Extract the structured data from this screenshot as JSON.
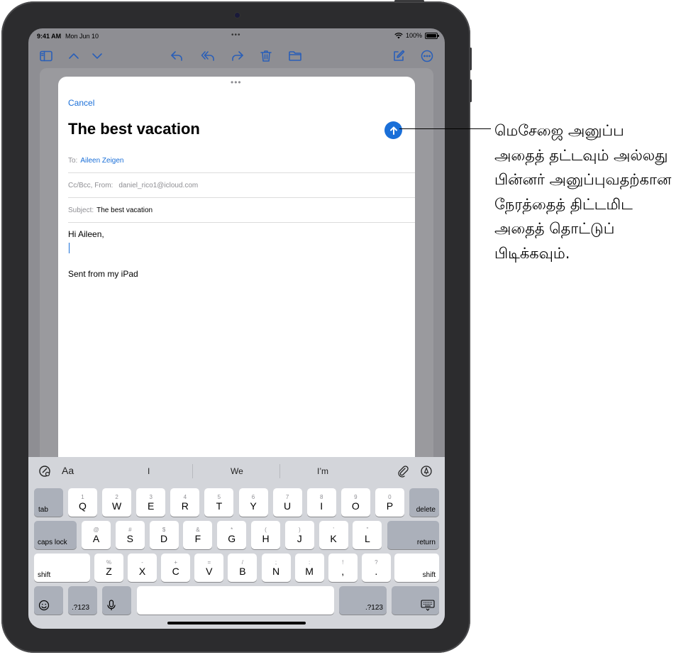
{
  "status": {
    "time": "9:41 AM",
    "date": "Mon Jun 10",
    "multitask_dots": "•••",
    "battery": "100%"
  },
  "toolbar": {
    "icons": [
      "sidebar-icon",
      "chevron-up-icon",
      "chevron-down-icon",
      "reply-icon",
      "reply-all-icon",
      "forward-icon",
      "trash-icon",
      "folder-icon",
      "compose-icon",
      "more-icon"
    ],
    "accent": "#2a5fb8"
  },
  "compose": {
    "grabber": "•••",
    "cancel_label": "Cancel",
    "title": "The best vacation",
    "to_label": "To:",
    "to_value": "Aileen Zeigen",
    "ccbcc_label": "Cc/Bcc, From:",
    "from_value": "daniel_rico1@icloud.com",
    "subject_label": "Subject:",
    "subject_value": "The best vacation",
    "greeting": "Hi Aileen,",
    "signature": "Sent from my iPad",
    "send_color": "#1a6fd8"
  },
  "predictive": {
    "format_label": "Aa",
    "suggestions": [
      "I",
      "We",
      "I’m"
    ]
  },
  "keyboard": {
    "row1": [
      {
        "main": "Q",
        "sub": "1"
      },
      {
        "main": "W",
        "sub": "2"
      },
      {
        "main": "E",
        "sub": "3"
      },
      {
        "main": "R",
        "sub": "4"
      },
      {
        "main": "T",
        "sub": "5"
      },
      {
        "main": "Y",
        "sub": "6"
      },
      {
        "main": "U",
        "sub": "7"
      },
      {
        "main": "I",
        "sub": "8"
      },
      {
        "main": "O",
        "sub": "9"
      },
      {
        "main": "P",
        "sub": "0"
      }
    ],
    "row2": [
      {
        "main": "A",
        "sub": "@"
      },
      {
        "main": "S",
        "sub": "#"
      },
      {
        "main": "D",
        "sub": "$"
      },
      {
        "main": "F",
        "sub": "&"
      },
      {
        "main": "G",
        "sub": "*"
      },
      {
        "main": "H",
        "sub": "("
      },
      {
        "main": "J",
        "sub": ")"
      },
      {
        "main": "K",
        "sub": "’"
      },
      {
        "main": "L",
        "sub": "\""
      }
    ],
    "row3": [
      {
        "main": "Z",
        "sub": "%"
      },
      {
        "main": "X",
        "sub": "-"
      },
      {
        "main": "C",
        "sub": "+"
      },
      {
        "main": "V",
        "sub": "="
      },
      {
        "main": "B",
        "sub": "/"
      },
      {
        "main": "N",
        "sub": ";"
      },
      {
        "main": "M",
        "sub": ":"
      },
      {
        "main": ",",
        "sub": "!"
      },
      {
        "main": ".",
        "sub": "?"
      }
    ],
    "tab": "tab",
    "delete": "delete",
    "caps_lock": "caps lock",
    "return": "return",
    "shift": "shift",
    "numbers": ".?123"
  },
  "callout": {
    "text": "மெசேஜை அனுப்ப அதைத் தட்டவும் அல்லது பின்னர் அனுப்புவதற்கான நேரத்தைத் திட்டமிட அதைத் தொட்டுப் பிடிக்கவும்."
  }
}
